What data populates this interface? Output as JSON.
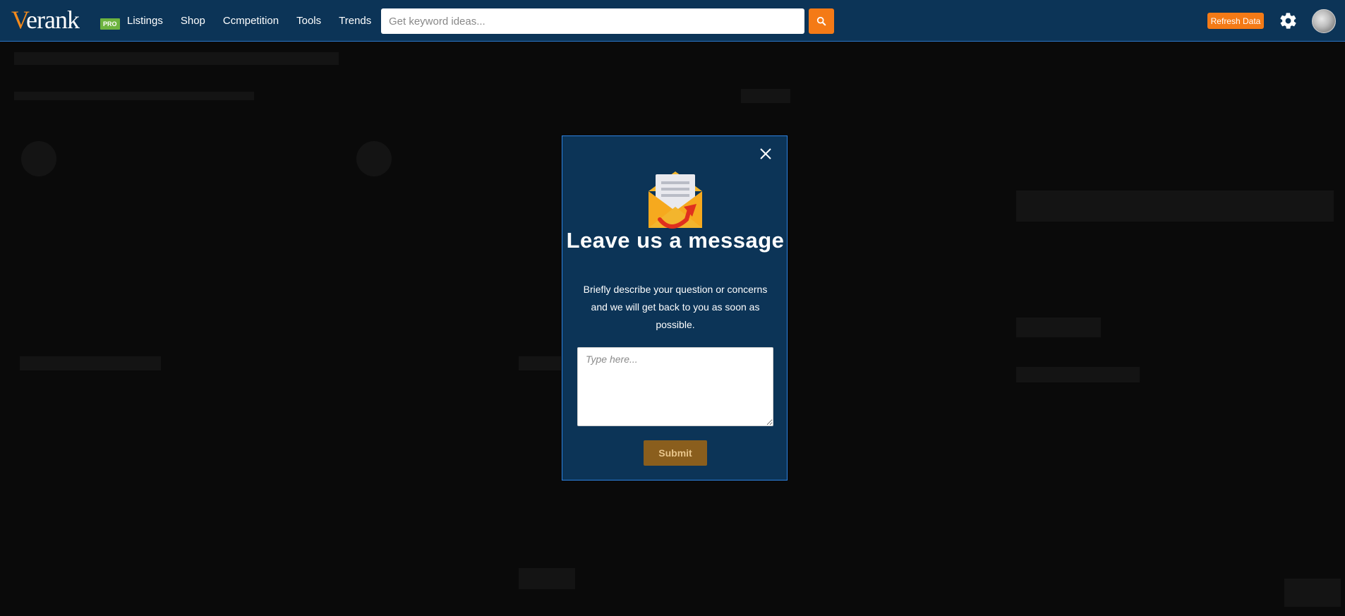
{
  "header": {
    "logo_text": "erank",
    "logo_initial": "V",
    "logo_badge": "PRO",
    "nav": [
      {
        "label": "Listings"
      },
      {
        "label": "Shop"
      },
      {
        "label": "Ccmpetition"
      },
      {
        "label": "Tools"
      },
      {
        "label": "Trends"
      }
    ],
    "search": {
      "placeholder": "Get keyword ideas...",
      "value": ""
    },
    "refresh_label": "Refresh Data"
  },
  "modal": {
    "title": "Leave us a message",
    "description": "Briefly describe your question or concerns and we will get back to you as soon as possible.",
    "message_placeholder": "Type here...",
    "submit_label": "Submit"
  },
  "colors": {
    "navbar": "#0c3457",
    "accent": "#f47a16",
    "modal_bg": "#0c3457",
    "modal_border": "#2d82e0",
    "submit_bg": "#8a5e1d",
    "badge": "#6db33f"
  },
  "icons": {
    "search": "search-icon",
    "settings": "gear-icon",
    "close": "close-icon",
    "envelope": "envelope-icon"
  }
}
